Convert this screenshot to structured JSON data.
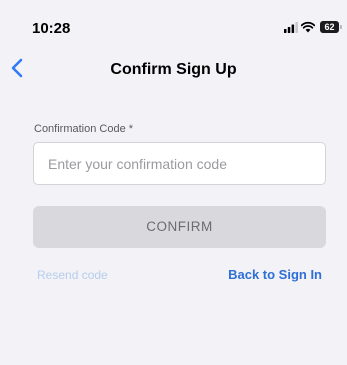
{
  "status_bar": {
    "time": "10:28",
    "battery_level": "62",
    "icons": [
      "signal-icon",
      "wifi-icon",
      "battery-icon"
    ]
  },
  "nav": {
    "back_icon": "chevron-left-icon",
    "title": "Confirm Sign Up"
  },
  "form": {
    "code_label": "Confirmation Code *",
    "code_value": "",
    "code_placeholder": "Enter your confirmation code",
    "confirm_label": "CONFIRM"
  },
  "links": {
    "resend": "Resend code",
    "back_to_sign_in": "Back to Sign In"
  },
  "colors": {
    "background": "#f2f2f7",
    "accent": "#2f6fd6",
    "disabled_link": "#b6cdeb",
    "button_disabled": "#d8d8dd"
  }
}
